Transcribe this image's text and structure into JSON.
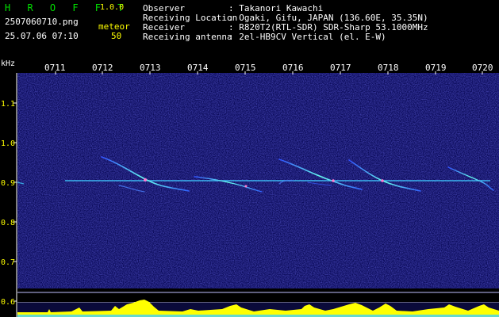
{
  "header": {
    "brand": "H R O F F T",
    "version": "1.0.0",
    "filename": "2507060710.png",
    "datetime": "25.07.06 07:10",
    "count_label": "meteor",
    "count_value": "50",
    "info_labels": [
      "Observer",
      "Receiving Location",
      "Receiver",
      "Receiving antenna"
    ],
    "info_values": [
      ": Takanori Kawachi",
      ": Ogaki, Gifu, JAPAN (136.60E, 35.35N)",
      ": R820T2(RTL-SDR) SDR-Sharp 53.1000MHz",
      ": 2el-HB9CV Vertical (el. E-W)"
    ]
  },
  "axis": {
    "unit": "kHz",
    "y_labels": [
      "1.1",
      "1.0",
      "0.9",
      "0.8",
      "0.7",
      "0.6"
    ],
    "x_labels": [
      "0711",
      "0712",
      "0713",
      "0714",
      "0715",
      "0716",
      "0717",
      "0718",
      "0719",
      "0720"
    ]
  },
  "colors": {
    "background": "#000000",
    "spectrum": "#1a1a8c",
    "carrier": "#40c8ff",
    "meteor": "#66ffee",
    "meter": "#ffff00",
    "label_yellow": "#ffff00",
    "label_white": "#ffffff",
    "brand_green": "#00e000"
  }
}
